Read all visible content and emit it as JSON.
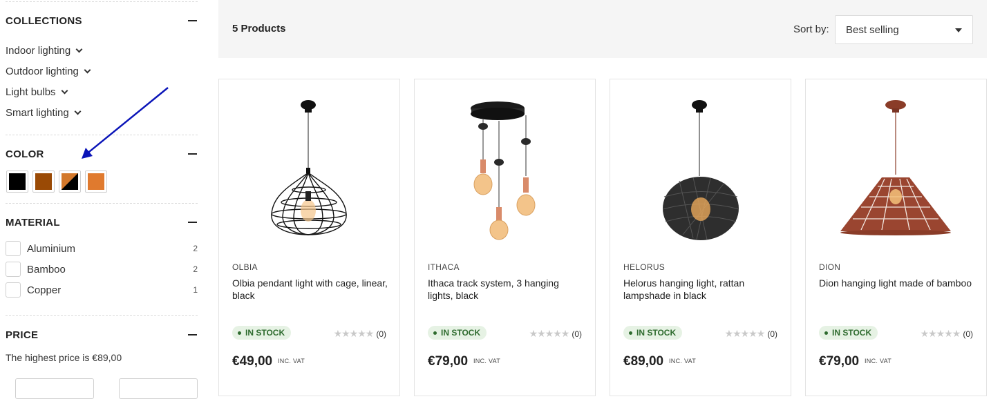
{
  "sidebar": {
    "collections": {
      "title": "COLLECTIONS",
      "items": [
        {
          "label": "Indoor lighting"
        },
        {
          "label": "Outdoor lighting"
        },
        {
          "label": "Light bulbs"
        },
        {
          "label": "Smart lighting"
        }
      ]
    },
    "color": {
      "title": "COLOR",
      "swatches": [
        {
          "name": "black",
          "color": "#000000"
        },
        {
          "name": "brown",
          "color": "#9a4a05"
        },
        {
          "name": "copper-black",
          "color": "#d3782b"
        },
        {
          "name": "orange",
          "color": "#e07a2e"
        }
      ]
    },
    "material": {
      "title": "MATERIAL",
      "items": [
        {
          "label": "Aluminium",
          "count": "2"
        },
        {
          "label": "Bamboo",
          "count": "2"
        },
        {
          "label": "Copper",
          "count": "1"
        }
      ]
    },
    "price": {
      "title": "PRICE",
      "note": "The highest price is €89,00"
    }
  },
  "toolbar": {
    "count": "5 Products",
    "sort_label": "Sort by:",
    "sort_value": "Best selling"
  },
  "products": [
    {
      "brand": "OLBIA",
      "name": "Olbia pendant light with cage, linear, black",
      "stock": "IN STOCK",
      "rating_count": "(0)",
      "price": "€49,00",
      "vat": "INC. VAT"
    },
    {
      "brand": "ITHACA",
      "name": "Ithaca track system, 3 hanging lights, black",
      "stock": "IN STOCK",
      "rating_count": "(0)",
      "price": "€79,00",
      "vat": "INC. VAT"
    },
    {
      "brand": "HELORUS",
      "name": "Helorus hanging light, rattan lampshade in black",
      "stock": "IN STOCK",
      "rating_count": "(0)",
      "price": "€89,00",
      "vat": "INC. VAT"
    },
    {
      "brand": "DION",
      "name": "Dion hanging light made of bamboo",
      "stock": "IN STOCK",
      "rating_count": "(0)",
      "price": "€79,00",
      "vat": "INC. VAT"
    }
  ],
  "colors": {
    "toolbar_bg": "#f5f5f5",
    "stock_bg": "#e6f2e4",
    "stock_text": "#2e6b2e",
    "annotation_arrow": "#0a14b8"
  }
}
